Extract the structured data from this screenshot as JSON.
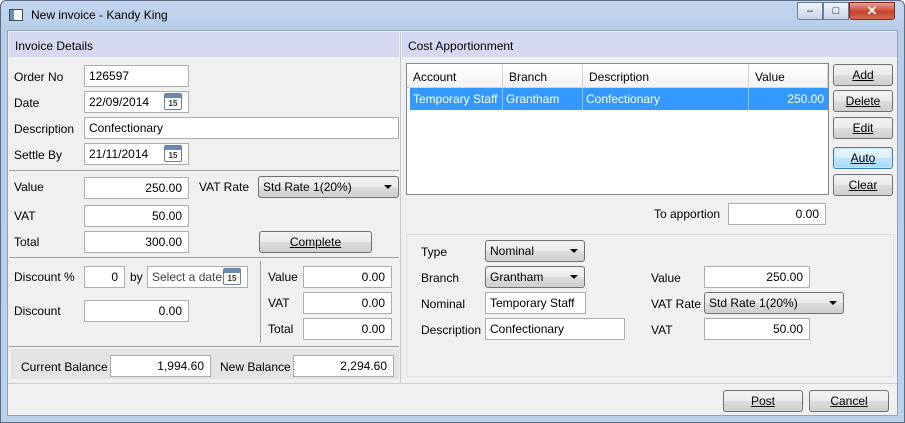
{
  "window": {
    "title": "New invoice - Kandy King",
    "min_glyph": "–",
    "max_glyph": "□",
    "close_glyph": "✕"
  },
  "invoice_details": {
    "header": "Invoice Details",
    "order_no_label": "Order No",
    "order_no": "126597",
    "date_label": "Date",
    "date": "22/09/2014",
    "description_label": "Description",
    "description": "Confectionary",
    "settle_by_label": "Settle By",
    "settle_by": "21/11/2014",
    "calendar_glyph": "15",
    "value_label": "Value",
    "value": "250.00",
    "vat_rate_label": "VAT Rate",
    "vat_rate": "Std Rate 1(20%)",
    "vat_label": "VAT",
    "vat": "50.00",
    "total_label": "Total",
    "total": "300.00",
    "complete_button": "Complete"
  },
  "discount": {
    "discount_pct_label": "Discount %",
    "discount_pct": "0",
    "by_label": "by",
    "date_placeholder": "Select a date",
    "discount_label": "Discount",
    "discount": "0.00",
    "value_label": "Value",
    "value": "0.00",
    "vat_label": "VAT",
    "vat": "0.00",
    "total_label": "Total",
    "total": "0.00"
  },
  "balance": {
    "current_label": "Current Balance",
    "current": "1,994.60",
    "new_label": "New Balance",
    "new": "2,294.60"
  },
  "cost_apportionment": {
    "header": "Cost Apportionment",
    "columns": [
      "Account",
      "Branch",
      "Description",
      "Value"
    ],
    "rows": [
      {
        "account": "Temporary Staff",
        "branch": "Grantham",
        "description": "Confectionary",
        "value": "250.00"
      }
    ],
    "buttons": {
      "add": "Add",
      "delete": "Delete",
      "edit": "Edit",
      "auto": "Auto",
      "clear": "Clear"
    },
    "to_apportion_label": "To apportion",
    "to_apportion": "0.00"
  },
  "line_editor": {
    "type_label": "Type",
    "type": "Nominal",
    "branch_label": "Branch",
    "branch": "Grantham",
    "nominal_label": "Nominal",
    "nominal": "Temporary Staff",
    "description_label": "Description",
    "description": "Confectionary",
    "value_label": "Value",
    "value": "250.00",
    "vat_rate_label": "VAT Rate",
    "vat_rate": "Std Rate 1(20%)",
    "vat_label": "VAT",
    "vat": "50.00"
  },
  "footer": {
    "post_button": "Post",
    "cancel_button": "Cancel"
  }
}
